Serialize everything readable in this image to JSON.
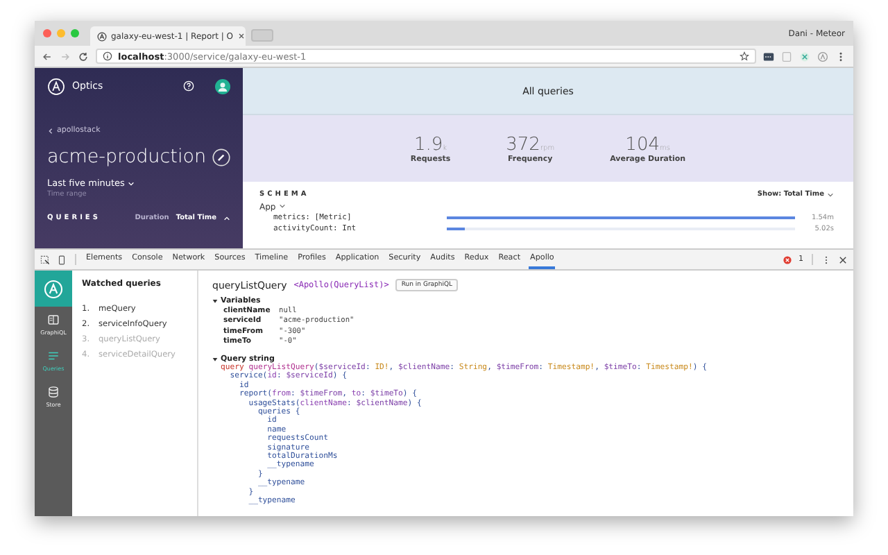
{
  "browser": {
    "tab_title": "galaxy-eu-west-1 | Report | O",
    "user": "Dani - Meteor",
    "url": "**localhost**:3000/service/galaxy-eu-west-1"
  },
  "sidebar": {
    "brand": "Optics",
    "back_link": "apollostack",
    "service": "acme-production",
    "time_range": "Last five minutes",
    "time_range_label": "Time range",
    "queries_heading": "QUERIES",
    "sort_options": [
      {
        "label": "Duration",
        "selected": false
      },
      {
        "label": "Total Time",
        "selected": true
      }
    ]
  },
  "header": {
    "title": "All queries"
  },
  "stats": [
    {
      "value": "1.9",
      "unit": "k",
      "label": "Requests"
    },
    {
      "value": "372",
      "unit": "rpm",
      "label": "Frequency"
    },
    {
      "value": "104",
      "unit": "ms",
      "label": "Average Duration"
    }
  ],
  "schema": {
    "heading": "SCHEMA",
    "show": "Show: Total Time",
    "type": "App",
    "fields": [
      {
        "name": "metrics: [Metric]",
        "level": 1.0,
        "reading": "1.54m"
      },
      {
        "name": "activityCount: Int",
        "level": 0.05,
        "reading": "5.02s"
      }
    ]
  },
  "devtools": {
    "tabs": [
      {
        "label": "Elements",
        "selected": false
      },
      {
        "label": "Console",
        "selected": false
      },
      {
        "label": "Network",
        "selected": false
      },
      {
        "label": "Sources",
        "selected": false
      },
      {
        "label": "Timeline",
        "selected": false
      },
      {
        "label": "Profiles",
        "selected": false
      },
      {
        "label": "Application",
        "selected": false
      },
      {
        "label": "Security",
        "selected": false
      },
      {
        "label": "Audits",
        "selected": false
      },
      {
        "label": "Redux",
        "selected": false
      },
      {
        "label": "React",
        "selected": false
      },
      {
        "label": "Apollo",
        "selected": true
      }
    ],
    "error_count": "1",
    "rail": [
      {
        "kind": "graphiql",
        "label": "GraphiQL",
        "selected": false
      },
      {
        "kind": "queries",
        "label": "Queries",
        "selected": true
      },
      {
        "kind": "store",
        "label": "Store",
        "selected": false
      }
    ],
    "watched_heading": "Watched queries",
    "watched": [
      {
        "index": "1.",
        "name": "meQuery",
        "dimmed": false
      },
      {
        "index": "2.",
        "name": "serviceInfoQuery",
        "dimmed": false
      },
      {
        "index": "3.",
        "name": "queryListQuery",
        "dimmed": true
      },
      {
        "index": "4.",
        "name": "serviceDetailQuery",
        "dimmed": true
      }
    ],
    "query_name": "queryListQuery",
    "component": "<Apollo(QueryList)>",
    "run_button": "Run in GraphiQL",
    "variables_heading": "Variables",
    "variables": [
      {
        "name": "clientName",
        "value": "null"
      },
      {
        "name": "serviceId",
        "value": "\"acme-production\""
      },
      {
        "name": "timeFrom",
        "value": "\"-300\""
      },
      {
        "name": "timeTo",
        "value": "\"-0\""
      }
    ],
    "query_heading": "Query string",
    "code": [
      [
        {
          "t": "query ",
          "kind": "kw"
        },
        {
          "t": "queryListQuery",
          "kind": "def"
        },
        {
          "t": "(",
          "kind": "p"
        },
        {
          "t": "$serviceId",
          "kind": "var"
        },
        {
          "t": ": ",
          "kind": "p"
        },
        {
          "t": "ID!",
          "kind": "type"
        },
        {
          "t": ", ",
          "kind": "p"
        },
        {
          "t": "$clientName",
          "kind": "var"
        },
        {
          "t": ": ",
          "kind": "p"
        },
        {
          "t": "String",
          "kind": "type"
        },
        {
          "t": ", ",
          "kind": "p"
        },
        {
          "t": "$timeFrom",
          "kind": "var"
        },
        {
          "t": ": ",
          "kind": "p"
        },
        {
          "t": "Timestamp!",
          "kind": "type"
        },
        {
          "t": ", ",
          "kind": "p"
        },
        {
          "t": "$timeTo",
          "kind": "var"
        },
        {
          "t": ": ",
          "kind": "p"
        },
        {
          "t": "Timestamp!",
          "kind": "type"
        },
        {
          "t": ") {",
          "kind": "p"
        }
      ],
      [
        {
          "t": "  service(",
          "kind": "p"
        },
        {
          "t": "id",
          "kind": "attr"
        },
        {
          "t": ": ",
          "kind": "p"
        },
        {
          "t": "$serviceId",
          "kind": "var"
        },
        {
          "t": ") {",
          "kind": "p"
        }
      ],
      [
        {
          "t": "    id",
          "kind": "p"
        }
      ],
      [
        {
          "t": "    report(",
          "kind": "p"
        },
        {
          "t": "from",
          "kind": "attr"
        },
        {
          "t": ": ",
          "kind": "p"
        },
        {
          "t": "$timeFrom",
          "kind": "var"
        },
        {
          "t": ", ",
          "kind": "p"
        },
        {
          "t": "to",
          "kind": "attr"
        },
        {
          "t": ": ",
          "kind": "p"
        },
        {
          "t": "$timeTo",
          "kind": "var"
        },
        {
          "t": ") {",
          "kind": "p"
        }
      ],
      [
        {
          "t": "      usageStats(",
          "kind": "p"
        },
        {
          "t": "clientName",
          "kind": "attr"
        },
        {
          "t": ": ",
          "kind": "p"
        },
        {
          "t": "$clientName",
          "kind": "var"
        },
        {
          "t": ") {",
          "kind": "p"
        }
      ],
      [
        {
          "t": "        queries {",
          "kind": "p"
        }
      ],
      [
        {
          "t": "          id",
          "kind": "p"
        }
      ],
      [
        {
          "t": "          name",
          "kind": "p"
        }
      ],
      [
        {
          "t": "          requestsCount",
          "kind": "p"
        }
      ],
      [
        {
          "t": "          signature",
          "kind": "p"
        }
      ],
      [
        {
          "t": "          totalDurationMs",
          "kind": "p"
        }
      ],
      [
        {
          "t": "          __typename",
          "kind": "p"
        }
      ],
      [
        {
          "t": "        }",
          "kind": "p"
        }
      ],
      [
        {
          "t": "        __typename",
          "kind": "p"
        }
      ],
      [
        {
          "t": "      }",
          "kind": "p"
        }
      ],
      [
        {
          "t": "      __typename",
          "kind": "p"
        }
      ]
    ]
  }
}
